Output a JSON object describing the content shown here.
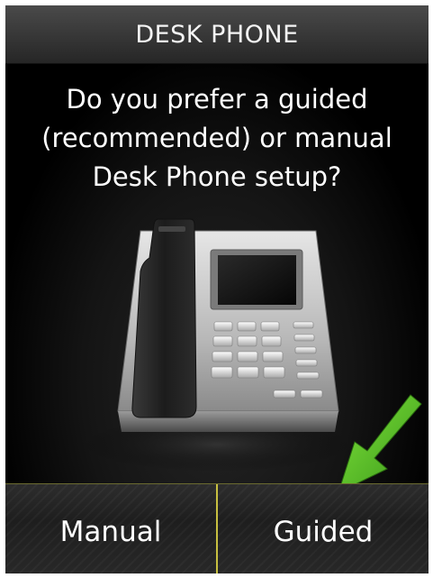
{
  "header": {
    "title": "DESK PHONE"
  },
  "prompt": {
    "question_lines": [
      "Do you prefer a guided",
      "(recommended) or manual",
      "Desk Phone setup?"
    ]
  },
  "illustration": {
    "icon": "desk-phone-icon",
    "hint_icon": "down-arrow-hint-icon",
    "hint_color": "#5fc42a"
  },
  "softkeys": {
    "left_label": "Manual",
    "right_label": "Guided",
    "divider_color": "#c8c040"
  }
}
